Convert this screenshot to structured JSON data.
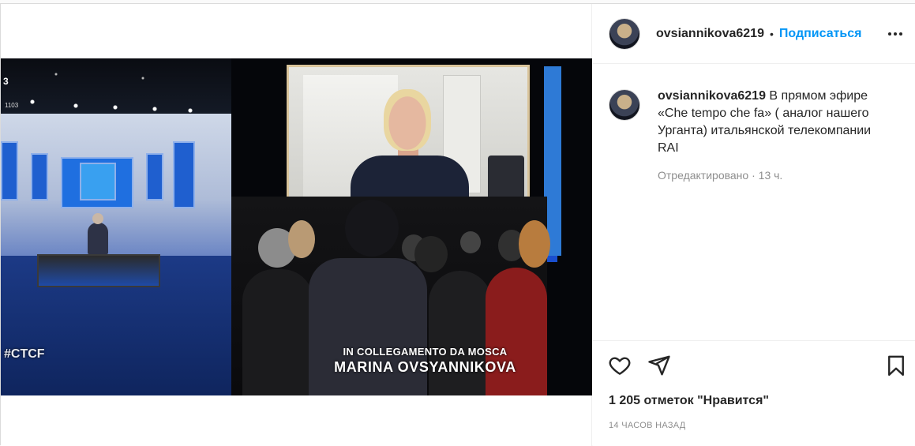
{
  "post": {
    "username": "ovsiannikova6219",
    "follow_label": "Подписаться",
    "separator": "•",
    "more_label": "•••",
    "caption_text": "В прямом эфире «Che tempo che fa» ( аналог нашего Урганта) итальянской телекомпании RAI",
    "edited_label": "Отредактировано",
    "edited_time": "13 ч.",
    "meta_separator": " · ",
    "likes": "1 205 отметок \"Нравится\"",
    "posted_ago": "14 ЧАСОВ НАЗАД"
  },
  "photo": {
    "channel": "3",
    "channel_small": "1103",
    "hashtag": "#CTCF",
    "tv_caption_line1": "IN COLLEGAMENTO DA MOSCA",
    "tv_caption_line2": "MARINA OVSYANNIKOVA"
  },
  "icons": {
    "like": "heart-icon",
    "share": "paper-plane-icon",
    "save": "bookmark-icon",
    "more": "ellipsis-icon"
  },
  "colors": {
    "accent": "#0095f6",
    "text": "#262626",
    "muted": "#8e8e8e"
  }
}
